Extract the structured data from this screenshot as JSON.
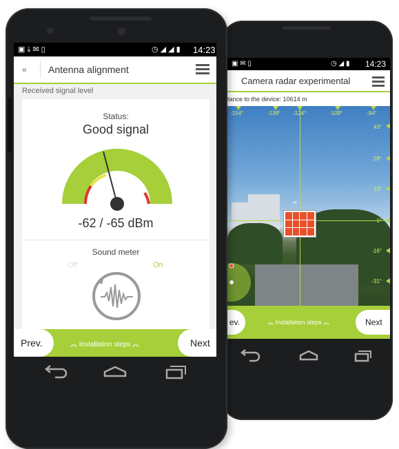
{
  "back_phone": {
    "status_time": "14:23",
    "title": "Camera radar experimental",
    "distance_text": "tance to the device: 10614 m",
    "top_ticks": [
      "-154°",
      "-139°",
      "-124°",
      "-109°",
      "-94°"
    ],
    "side_ticks": [
      "43°",
      "28°",
      "13°",
      "-1°",
      "-16°",
      "-31°"
    ],
    "target_label": "rx",
    "prev_label": "ev.",
    "steps_label": "︽ Installation steps ︽",
    "next_label": "Next"
  },
  "front_phone": {
    "status_time": "14:23",
    "title": "Antenna alignment",
    "section_label": "Received signal level",
    "status_caption": "Status:",
    "status_value": "Good signal",
    "signal_level": "-62 / -65 dBm",
    "sound_title": "Sound meter",
    "sound_off": "Off",
    "sound_on": "On",
    "prev_label": "Prev.",
    "steps_label": "︽ Installation steps ︽",
    "next_label": "Next",
    "back_icon": "«"
  },
  "colors": {
    "accent": "#a6cf39",
    "warning": "#e8e14a",
    "danger": "#d9372a"
  },
  "icons": {
    "back": "double-chevron-left-icon",
    "menu": "hamburger-menu-icon",
    "sound": "sound-wave-icon",
    "nav_back": "nav-back-icon",
    "nav_home": "nav-home-icon",
    "nav_recents": "nav-recents-icon"
  }
}
